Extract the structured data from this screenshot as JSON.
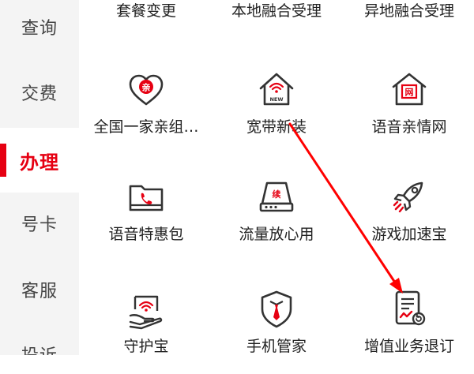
{
  "sidebar": {
    "items": [
      {
        "label": "查询"
      },
      {
        "label": "交费"
      },
      {
        "label": "办理",
        "active": true
      },
      {
        "label": "号卡"
      },
      {
        "label": "客服"
      },
      {
        "label": "投诉"
      }
    ]
  },
  "grid": {
    "top_row": [
      {
        "label": "套餐变更"
      },
      {
        "label": "本地融合受理"
      },
      {
        "label": "异地融合受理"
      }
    ],
    "row1": [
      {
        "label": "全国一家亲组…",
        "icon": "heart-family-icon",
        "badge": "亲"
      },
      {
        "label": "宽带新装",
        "icon": "house-wifi-icon",
        "badge": "NEW"
      },
      {
        "label": "语音亲情网",
        "icon": "voice-family-network-icon",
        "badge": "网"
      }
    ],
    "row2": [
      {
        "label": "语音特惠包",
        "icon": "folder-phone-icon"
      },
      {
        "label": "流量放心用",
        "icon": "data-router-icon",
        "badge": "续"
      },
      {
        "label": "游戏加速宝",
        "icon": "rocket-icon"
      }
    ],
    "row3": [
      {
        "label": "守护宝",
        "icon": "hand-wifi-icon"
      },
      {
        "label": "手机管家",
        "icon": "shield-tie-icon"
      },
      {
        "label": "增值业务退订",
        "icon": "document-refund-icon"
      }
    ]
  },
  "colors": {
    "accent": "#e60012",
    "icon_stroke": "#333333",
    "arrow": "#ff0000",
    "sidebar_bg": "#f4f4f4"
  }
}
